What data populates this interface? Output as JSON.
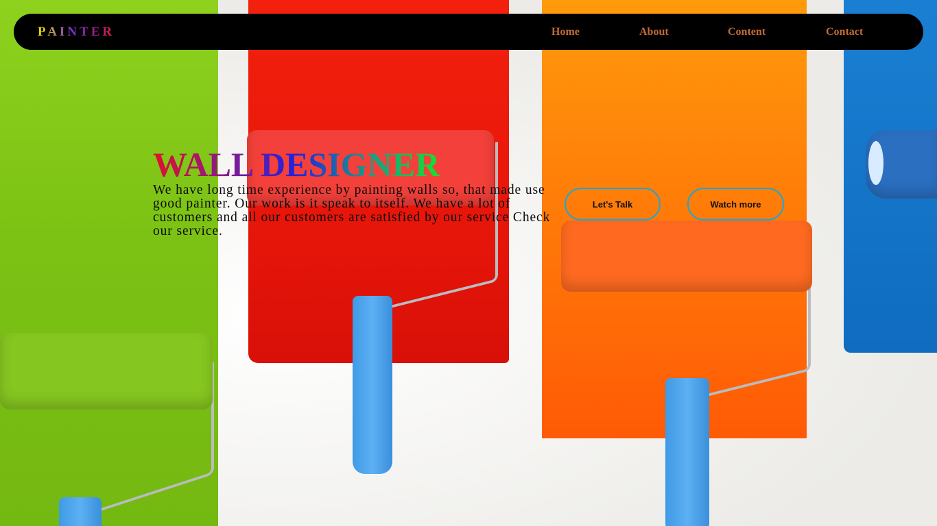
{
  "nav": {
    "brand": "PAINTER",
    "links": [
      {
        "label": "Home"
      },
      {
        "label": "About"
      },
      {
        "label": "Content"
      },
      {
        "label": "Contact"
      }
    ]
  },
  "hero": {
    "title": "WALL DESIGNER",
    "description": "We have long time experience by painting walls so, that made use good painter. Our work is it speak to itself. We have a lot of customers and all our customers are satisfied by our service Check our service.",
    "buttons": [
      {
        "label": "Let's Talk"
      },
      {
        "label": "Watch more"
      }
    ]
  },
  "background": {
    "image_subject": "paint-rollers-icon",
    "colors": {
      "green": "#7cc214",
      "red": "#e8160a",
      "orange": "#ff7a08",
      "blue": "#0f6cc0",
      "nav": "#000000",
      "nav_link": "#c26a35",
      "button_border": "#1fa6d6"
    }
  }
}
